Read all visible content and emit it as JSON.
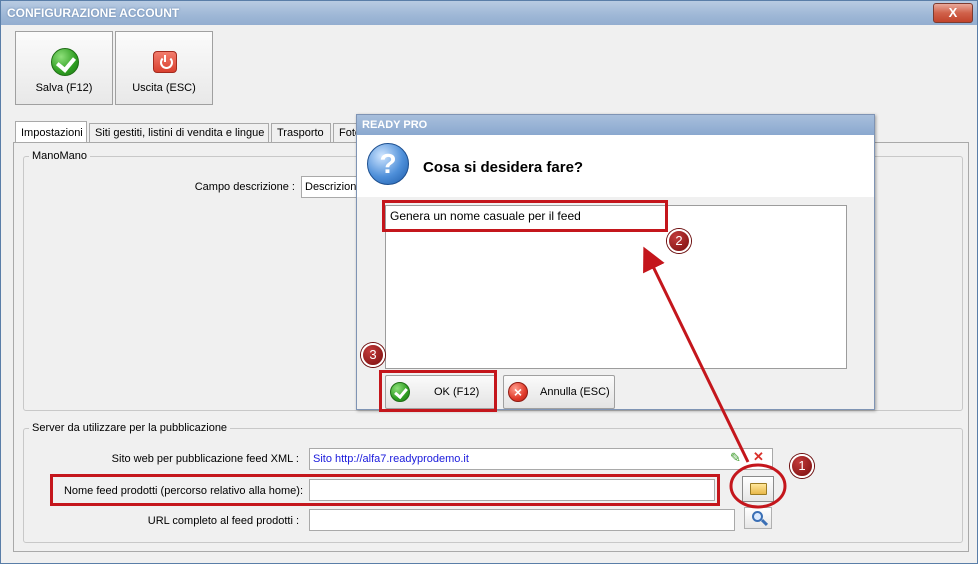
{
  "window": {
    "title": "CONFIGURAZIONE ACCOUNT",
    "close_glyph": "X"
  },
  "toolbar": {
    "save_label": "Salva (F12)",
    "exit_label": "Uscita (ESC)"
  },
  "tabs": [
    {
      "label": "Impostazioni",
      "active": true
    },
    {
      "label": "Siti gestiti, listini di vendita e lingue"
    },
    {
      "label": "Trasporto"
    },
    {
      "label": "Foto"
    }
  ],
  "manomano": {
    "group_title": "ManoMano",
    "campo_descrizione_label": "Campo descrizione :",
    "campo_descrizione_value": "Descrizione"
  },
  "server": {
    "group_title": "Server da utilizzare per la pubblicazione",
    "sito_web_label": "Sito web per pubblicazione feed XML :",
    "sito_web_value": "Sito http://alfa7.readyprodemo.it",
    "nome_feed_label": "Nome feed prodotti (percorso relativo alla home):",
    "nome_feed_value": "",
    "url_feed_label": "URL completo al feed prodotti :",
    "url_feed_value": ""
  },
  "dialog": {
    "title": "READY PRO",
    "question": "Cosa si desidera fare?",
    "options": [
      "Genera un nome casuale per il feed"
    ],
    "ok_label": "OK (F12)",
    "cancel_label": "Annulla (ESC)",
    "question_glyph": "?"
  },
  "annotations": {
    "badge1": "1",
    "badge2": "2",
    "badge3": "3"
  },
  "colors": {
    "annotation_red": "#c4161c",
    "link_blue": "#1a1adc",
    "titlebar": "#9eb7d6"
  }
}
